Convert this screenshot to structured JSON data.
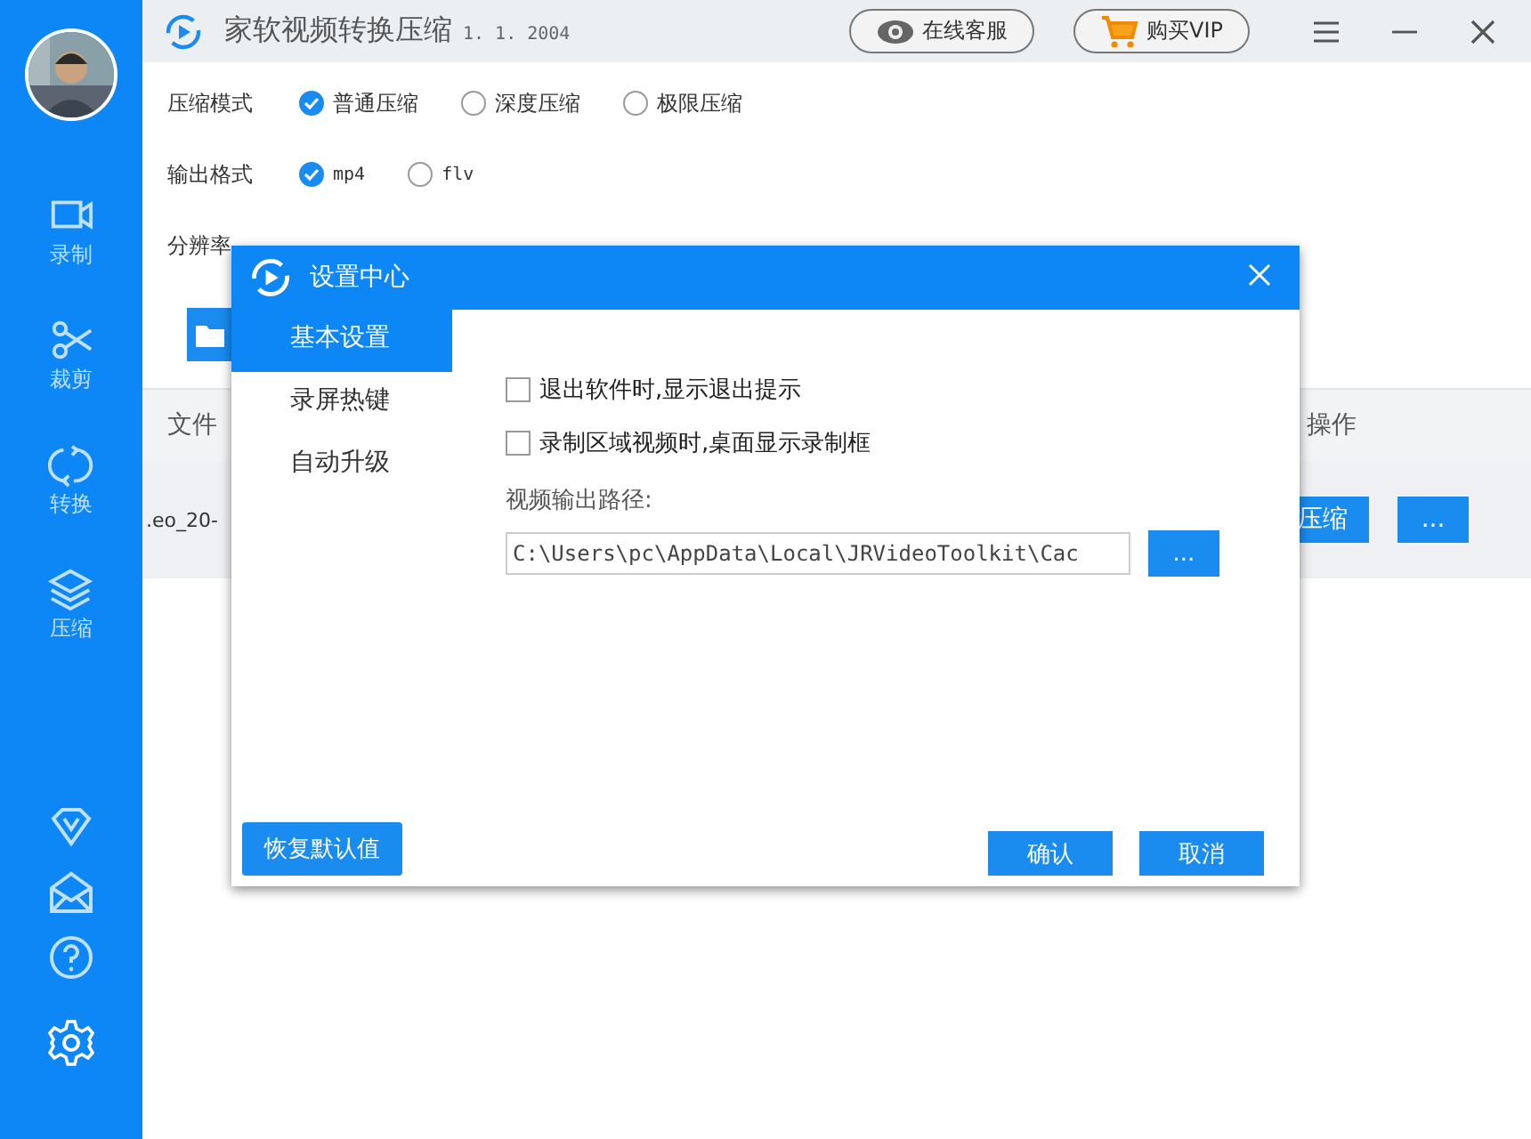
{
  "sidebar": {
    "items": [
      {
        "label": "录制"
      },
      {
        "label": "裁剪"
      },
      {
        "label": "转换"
      },
      {
        "label": "压缩"
      }
    ]
  },
  "title_bar": {
    "title": "家软视频转换压缩",
    "version": "1. 1. 2004",
    "buttons": [
      "在线客服",
      "购买VIP"
    ]
  },
  "compress_mode": {
    "label": "压缩模式",
    "options": [
      {
        "label": "普通压缩",
        "selected": true
      },
      {
        "label": "深度压缩",
        "selected": false
      },
      {
        "label": "极限压缩",
        "selected": false
      }
    ]
  },
  "output_format": {
    "label": "输出格式",
    "options": [
      {
        "label": "mp4",
        "selected": true
      },
      {
        "label": "flv",
        "selected": false
      }
    ]
  },
  "resolution": {
    "label": "分辨率"
  },
  "table": {
    "columns": [
      "文件",
      "操作"
    ],
    "rows": [
      {
        "file": ".eo_20-",
        "actions": [
          "压缩",
          "..."
        ]
      }
    ]
  },
  "dialog": {
    "title": "设置中心",
    "nav": [
      {
        "label": "基本设置",
        "selected": true
      },
      {
        "label": "录屏热键",
        "selected": false
      },
      {
        "label": "自动升级",
        "selected": false
      }
    ],
    "options": [
      {
        "label": "退出软件时,显示退出提示",
        "checked": false
      },
      {
        "label": "录制区域视频时,桌面显示录制框",
        "checked": false
      }
    ],
    "path_label": "视频输出路径:",
    "path_value": "C:\\Users\\pc\\AppData\\Local\\JRVideoToolkit\\Cac",
    "browse": "...",
    "reset": "恢复默认值",
    "confirm": "确认",
    "cancel": "取消"
  }
}
